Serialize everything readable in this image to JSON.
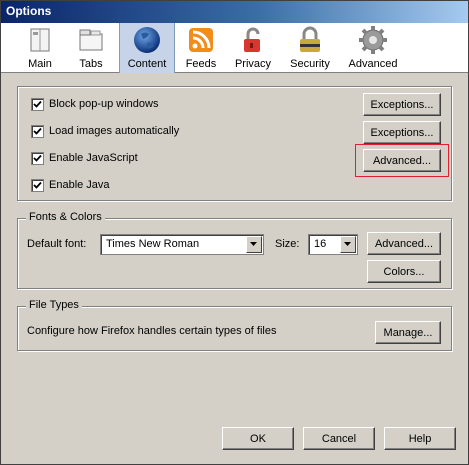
{
  "window": {
    "title": "Options"
  },
  "toolbar": {
    "items": [
      {
        "label": "Main",
        "icon": "main-icon"
      },
      {
        "label": "Tabs",
        "icon": "tabs-icon"
      },
      {
        "label": "Content",
        "icon": "globe-icon",
        "selected": true
      },
      {
        "label": "Feeds",
        "icon": "rss-icon"
      },
      {
        "label": "Privacy",
        "icon": "lock-icon"
      },
      {
        "label": "Security",
        "icon": "padlock-icon"
      },
      {
        "label": "Advanced",
        "icon": "gear-icon"
      }
    ]
  },
  "content": {
    "checkboxes": [
      {
        "label": "Block pop-up windows",
        "checked": true
      },
      {
        "label": "Load images automatically",
        "checked": true
      },
      {
        "label": "Enable JavaScript",
        "checked": true
      },
      {
        "label": "Enable Java",
        "checked": true
      }
    ],
    "exceptions_label_1": "Exceptions...",
    "exceptions_label_2": "Exceptions...",
    "advanced_js_label": "Advanced..."
  },
  "fonts": {
    "group_title": "Fonts & Colors",
    "default_font_label": "Default font:",
    "default_font_value": "Times New Roman",
    "size_label": "Size:",
    "size_value": "16",
    "advanced_label": "Advanced...",
    "colors_label": "Colors..."
  },
  "filetypes": {
    "group_title": "File Types",
    "description": "Configure how Firefox handles certain types of files",
    "manage_label": "Manage..."
  },
  "footer": {
    "ok_label": "OK",
    "cancel_label": "Cancel",
    "help_label": "Help"
  },
  "colors": {
    "title_start": "#0a246a",
    "title_end": "#a6caf0",
    "highlight": "#e0202e",
    "dialog_bg": "#d4d0c8"
  }
}
